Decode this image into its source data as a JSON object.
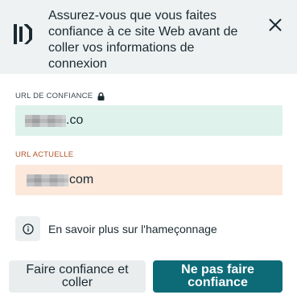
{
  "header": {
    "logo_icon": "dashlane-logo-icon",
    "message": "Assurez-vous que vous faites confiance à ce site Web avant de coller vos informations de connexion",
    "close_icon": "close-icon"
  },
  "trusted_url": {
    "label": "URL DE CONFIANCE",
    "label_icon": "lock-icon",
    "value": ".co"
  },
  "current_url": {
    "label": "URL ACTUELLE",
    "value": "com"
  },
  "info": {
    "icon": "info-icon",
    "link_text": "En savoir plus sur l'hameçonnage"
  },
  "buttons": {
    "trust_and_paste": "Faire confiance et coller",
    "do_not_trust": "Ne pas faire confiance"
  },
  "colors": {
    "header_bg": "#eef2f3",
    "trusted_box_bg": "#dff2ec",
    "current_box_bg": "#fce9dc",
    "current_label": "#b0562a",
    "primary_button": "#0d6b78",
    "secondary_button": "#e9edee"
  }
}
